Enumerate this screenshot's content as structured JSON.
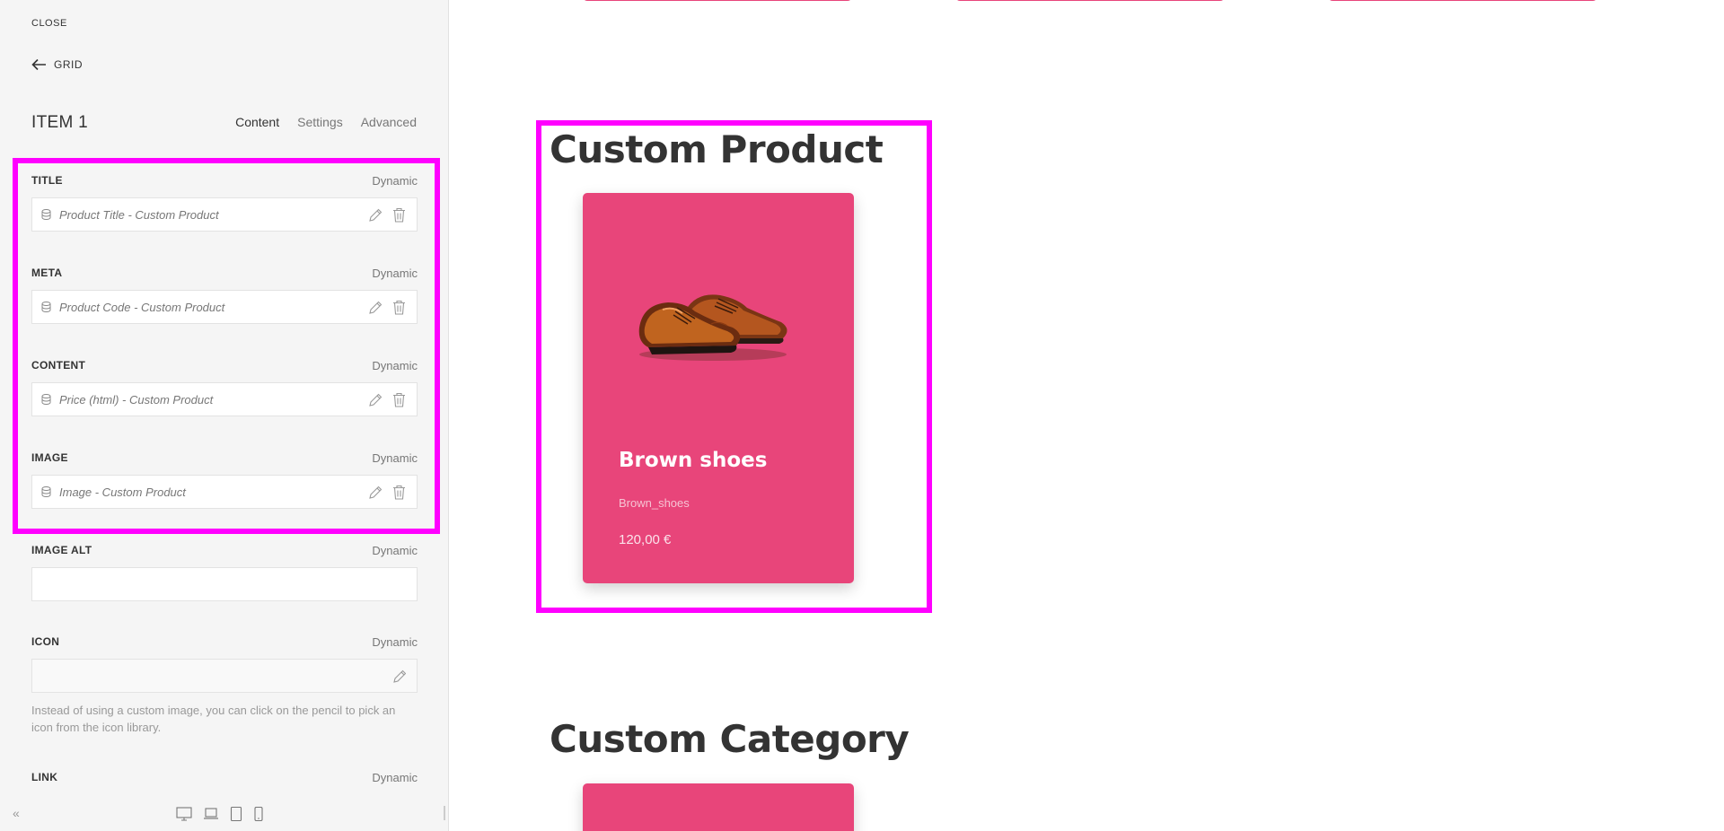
{
  "sidebar": {
    "close_label": "CLOSE",
    "back_label": "GRID",
    "item_title": "ITEM 1",
    "tabs": [
      {
        "label": "Content",
        "active": true
      },
      {
        "label": "Settings",
        "active": false
      },
      {
        "label": "Advanced",
        "active": false
      }
    ],
    "dynamic_label": "Dynamic",
    "fields": {
      "title": {
        "label": "TITLE",
        "value": "Product Title - Custom Product"
      },
      "meta": {
        "label": "META",
        "value": "Product Code - Custom Product"
      },
      "content": {
        "label": "CONTENT",
        "value": "Price (html) - Custom Product"
      },
      "image": {
        "label": "IMAGE",
        "value": "Image - Custom Product"
      },
      "image_alt": {
        "label": "IMAGE ALT",
        "value": ""
      },
      "icon": {
        "label": "ICON",
        "value": "",
        "hint": "Instead of using a custom image, you can click on the pencil to pick an icon from the icon library."
      },
      "link": {
        "label": "LINK"
      }
    },
    "collapse_label": "«"
  },
  "canvas": {
    "section1_title": "Custom Product",
    "section2_title": "Custom Category",
    "product_card": {
      "title": "Brown shoes",
      "meta": "Brown_shoes",
      "price": "120,00 €"
    }
  },
  "colors": {
    "card_pink": "#e8457a",
    "highlight": "#ff00ff",
    "sidebar_bg": "#f5f5f5"
  },
  "icons": [
    "arrow-left-icon",
    "database-icon",
    "pencil-icon",
    "trash-icon",
    "desktop-icon",
    "laptop-icon",
    "tablet-icon",
    "phone-icon"
  ]
}
